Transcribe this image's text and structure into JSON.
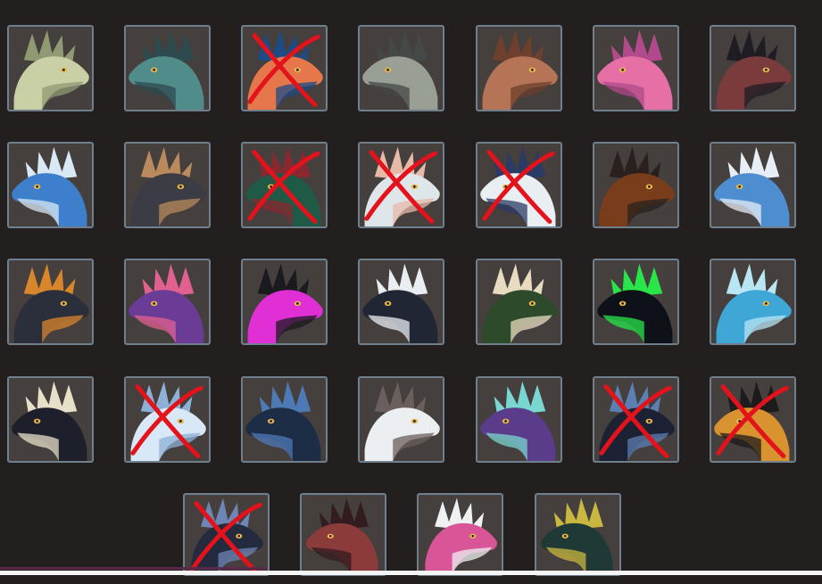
{
  "colors": {
    "background": "#231f1f",
    "tile_fill": "#453f3e",
    "tile_border": "#6f7f8c",
    "cross_mark": "#e3121b"
  },
  "tiles": [
    {
      "icon": "pale-horned-dragon-head-icon",
      "palette": [
        "#c9d0a6",
        "#8f9a72"
      ],
      "crossed": false
    },
    {
      "icon": "teal-serpent-dragon-head-icon",
      "palette": [
        "#4f8c8a",
        "#2d4a4e"
      ],
      "crossed": false
    },
    {
      "icon": "orange-blue-frilled-dragon-head-icon",
      "palette": [
        "#e5774a",
        "#1e4b86"
      ],
      "crossed": true
    },
    {
      "icon": "armored-grey-dragon-head-icon",
      "palette": [
        "#9a9f96",
        "#444846"
      ],
      "crossed": false
    },
    {
      "icon": "brown-spiked-dragon-head-icon",
      "palette": [
        "#b57456",
        "#6e3f2c"
      ],
      "crossed": false
    },
    {
      "icon": "pink-axolotl-dragon-head-icon",
      "palette": [
        "#e66fa6",
        "#b04a8a"
      ],
      "crossed": false
    },
    {
      "icon": "dark-red-crested-dragon-head-icon",
      "palette": [
        "#7a3b3d",
        "#1f1c24"
      ],
      "crossed": false
    },
    {
      "icon": "blue-white-dragon-head-icon",
      "palette": [
        "#3e7fcc",
        "#d8e8f4"
      ],
      "crossed": false
    },
    {
      "icon": "black-tan-dragon-head-icon",
      "palette": [
        "#3b3c44",
        "#b88a5c"
      ],
      "crossed": false
    },
    {
      "icon": "green-red-dragon-head-icon",
      "palette": [
        "#1f5a46",
        "#8a2830"
      ],
      "crossed": true
    },
    {
      "icon": "white-feathered-dragon-head-icon",
      "palette": [
        "#dfe6ea",
        "#e7b9a8"
      ],
      "crossed": true
    },
    {
      "icon": "zebra-striped-dragon-head-icon",
      "palette": [
        "#e9eef2",
        "#2b3b66"
      ],
      "crossed": true
    },
    {
      "icon": "bronze-horned-beetle-dragon-head-icon",
      "palette": [
        "#7a3d1c",
        "#2a211e"
      ],
      "crossed": false
    },
    {
      "icon": "blue-shark-dragon-head-icon",
      "palette": [
        "#4e8ed0",
        "#e6eef6"
      ],
      "crossed": false
    },
    {
      "icon": "black-orange-dragon-head-icon",
      "palette": [
        "#2b2f3b",
        "#d8862c"
      ],
      "crossed": false
    },
    {
      "icon": "purple-pink-scaled-dragon-head-icon",
      "palette": [
        "#6b3c96",
        "#e0608f"
      ],
      "crossed": false
    },
    {
      "icon": "magenta-winged-dragon-head-icon",
      "palette": [
        "#e12fd6",
        "#1a1a1f"
      ],
      "crossed": false
    },
    {
      "icon": "black-white-spined-dragon-head-icon",
      "palette": [
        "#202634",
        "#e9eef2"
      ],
      "crossed": false
    },
    {
      "icon": "green-cream-dragon-head-icon",
      "palette": [
        "#2d4a2b",
        "#e7dcc0"
      ],
      "crossed": false
    },
    {
      "icon": "neon-green-dragon-head-icon",
      "palette": [
        "#0f1118",
        "#28e64a"
      ],
      "crossed": false
    },
    {
      "icon": "cyan-coral-dragon-head-icon",
      "palette": [
        "#3fa7d6",
        "#b8e6f2"
      ],
      "crossed": false
    },
    {
      "icon": "black-cream-dragon-head-icon",
      "palette": [
        "#1d1f2a",
        "#e7e0c8"
      ],
      "crossed": false
    },
    {
      "icon": "white-blue-fox-dragon-head-icon",
      "palette": [
        "#d9e8f6",
        "#8cb0d6"
      ],
      "crossed": true
    },
    {
      "icon": "dark-blue-striped-dragon-head-icon",
      "palette": [
        "#1c2d45",
        "#4d79b5"
      ],
      "crossed": false
    },
    {
      "icon": "white-grey-feathered-dragon-head-icon",
      "palette": [
        "#eceff1",
        "#6a5f5c"
      ],
      "crossed": false
    },
    {
      "icon": "purple-tendril-dragon-head-icon",
      "palette": [
        "#5a3c8a",
        "#7ad6d0"
      ],
      "crossed": false
    },
    {
      "icon": "dark-blue-black-dragon-head-icon",
      "palette": [
        "#1c2233",
        "#5b7fb0"
      ],
      "crossed": true
    },
    {
      "icon": "tiger-striped-dragon-head-icon",
      "palette": [
        "#d8922f",
        "#1d1b1c"
      ],
      "crossed": true
    },
    {
      "icon": "black-blue-crested-dragon-head-icon",
      "palette": [
        "#242b3e",
        "#6d86b5"
      ],
      "crossed": true
    },
    {
      "icon": "crimson-horned-dragon-head-icon",
      "palette": [
        "#8a3b3a",
        "#321c20"
      ],
      "crossed": false
    },
    {
      "icon": "pink-striped-dragon-head-icon",
      "palette": [
        "#d85598",
        "#eef0f2"
      ],
      "crossed": false
    },
    {
      "icon": "dark-green-gold-dragon-head-icon",
      "palette": [
        "#1f3a36",
        "#c9b83f"
      ],
      "crossed": false
    }
  ]
}
